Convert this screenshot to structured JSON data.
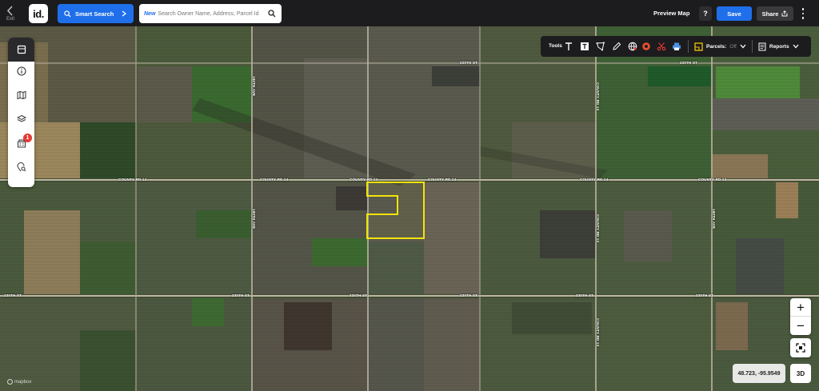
{
  "topbar": {
    "exit_label": "Exit",
    "logo_text": "id.",
    "smart_search_label": "Smart Search",
    "search_new_tag": "New",
    "search_placeholder": "Search Owner Name, Address, Parcel Id",
    "preview_map_label": "Preview Map",
    "help_label": "?",
    "save_label": "Save",
    "share_label": "Share"
  },
  "sidebar": {
    "items": [
      {
        "icon": "panel-icon"
      },
      {
        "icon": "info-icon"
      },
      {
        "icon": "map-icon"
      },
      {
        "icon": "layers-icon"
      },
      {
        "icon": "buildings-icon",
        "badge": "1"
      },
      {
        "icon": "location-search-icon"
      }
    ]
  },
  "toolsbar": {
    "tools_label": "Tools",
    "tools": [
      "text-icon",
      "text-box-icon",
      "polygon-icon",
      "pencil-icon",
      "globe-icon",
      "circle-icon",
      "scissors-icon",
      "print-icon"
    ],
    "parcels_label": "Parcels:",
    "parcels_value": "Off",
    "reports_label": "Reports"
  },
  "map": {
    "road_labels": {
      "county_rd_14_a": "COUNTY RD 14",
      "county_rd_14_b": "COUNTY RD 14",
      "county_rd_14_c": "COUNTY RD 14",
      "county_rd_14_d": "COUNTY RD 14",
      "county_rd_14_e": "COUNTY RD 14",
      "county_rd_14_f": "COUNTY RD 14",
      "st_230_a": "230TH ST",
      "st_230_b": "230TH ST",
      "st_230_c": "230TH ST",
      "st_230_d": "230TH ST",
      "st_230_e": "230TH ST",
      "st_230_f": "230TH ST",
      "st_220_a": "220TH ST",
      "st_220_b": "220TH ST",
      "county_rd_13_a": "COUNTY RD 13",
      "county_rd_13_b": "COUNTY RD 13",
      "county_rd_13_c": "COUNTY RD 13",
      "ave_a": "180TH AVE",
      "ave_b": "180TH AVE",
      "ave_c": "180TH AVE"
    },
    "highlight_color": "#f2e30c",
    "attribution": "mapbox"
  },
  "controls": {
    "zoom_in_label": "+",
    "zoom_out_label": "−",
    "coordinates": "48.723, -95.9549",
    "three_d_label": "3D"
  }
}
